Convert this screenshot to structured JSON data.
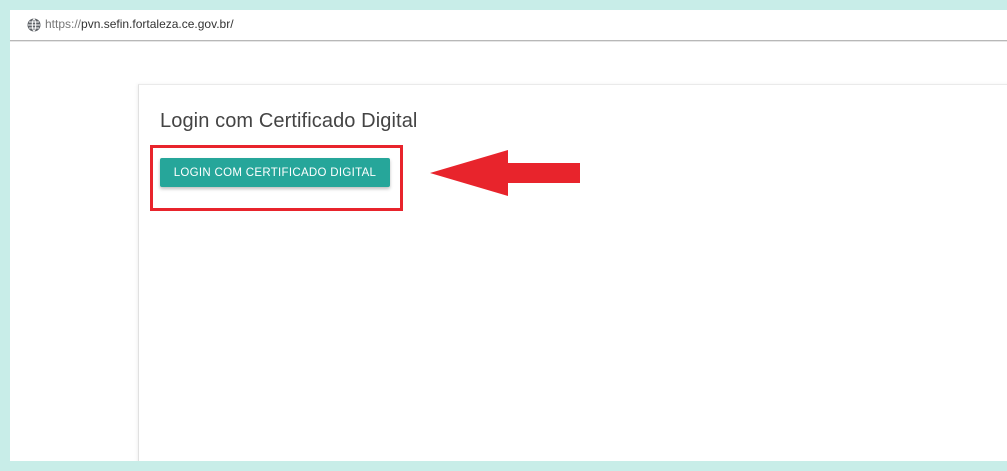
{
  "browser": {
    "url_scheme": "https://",
    "url_rest": "pvn.sefin.fortaleza.ce.gov.br/"
  },
  "page": {
    "title": "Login com Certificado Digital",
    "login_button_label": "LOGIN COM CERTIFICADO DIGITAL"
  },
  "icons": {
    "site_info": "globe-icon",
    "annotation_arrow": "arrow-left-icon"
  },
  "colors": {
    "background": "#c8ede8",
    "button": "#26a69a",
    "annotation": "#e8242c"
  }
}
